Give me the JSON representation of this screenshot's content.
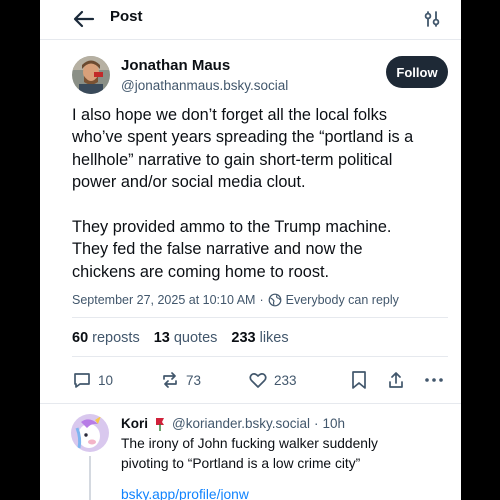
{
  "header": {
    "title": "Post",
    "back_icon": "arrow-left-icon",
    "thread_icon": "sliders-icon"
  },
  "post": {
    "author_name": "Jonathan Maus",
    "author_handle": "@jonathanmaus.bsky.social",
    "follow_label": "Follow",
    "text": "I also hope we don’t forget all the local folks who’ve spent years spreading the “portland is a hellhole” narrative to gain short-term political power and/or social media clout.\n\nThey provided ammo to the Trump machine. They fed the false narrative and now the chickens are coming home to roost.",
    "timestamp": "September 27, 2025 at 10:10 AM",
    "separator": "·",
    "reply_setting": "Everybody can reply"
  },
  "stats": {
    "reposts_count": "60",
    "reposts_label": "reposts",
    "quotes_count": "13",
    "quotes_label": "quotes",
    "likes_count": "233",
    "likes_label": "likes"
  },
  "actions": {
    "reply_count": "10",
    "repost_count": "73",
    "like_count": "233"
  },
  "reply": {
    "author_name": "Kori",
    "author_handle": "@koriander.bsky.social",
    "separator": "·",
    "time": "10h",
    "text": "The irony of John fucking walker suddenly pivoting to “Portland is a low crime city”",
    "link": "bsky.app/profile/jonw"
  },
  "colors": {
    "accent": "#1083fe",
    "muted": "#42576c",
    "follow_bg": "#1e2936"
  }
}
